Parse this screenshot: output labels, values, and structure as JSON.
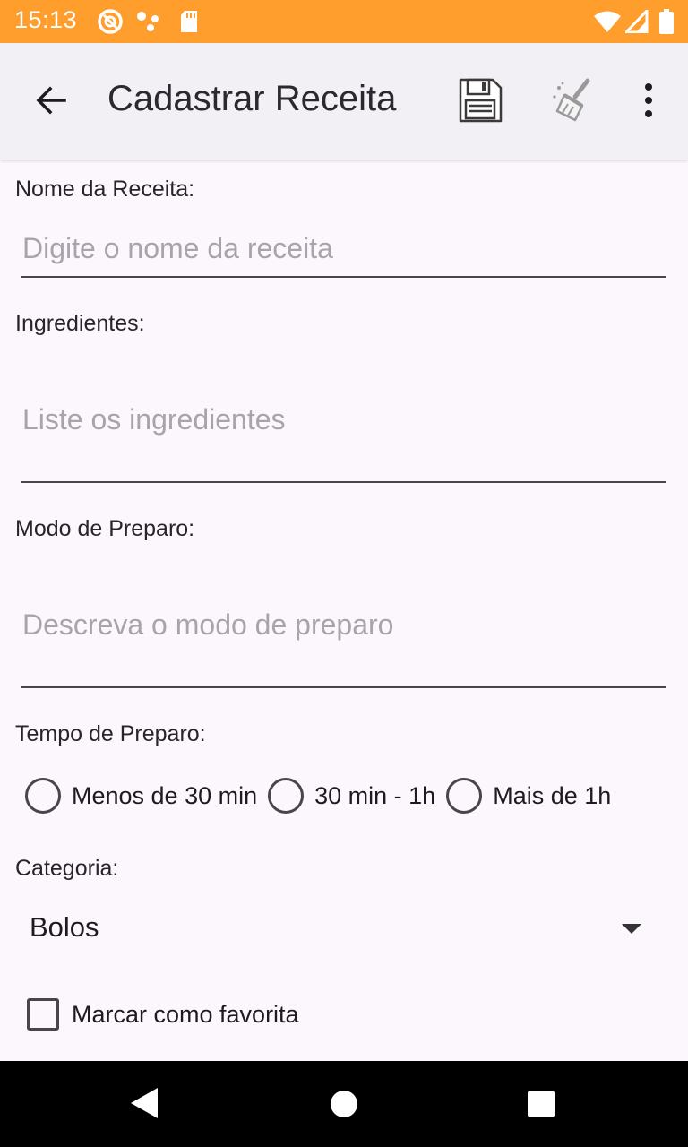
{
  "status_bar": {
    "time": "15:13",
    "icons": [
      "at-sign-icon",
      "dots-icon",
      "sd-card-icon",
      "wifi-icon",
      "signal-icon",
      "battery-icon"
    ],
    "background": "#ff9e2c"
  },
  "app_bar": {
    "title": "Cadastrar Receita",
    "actions": [
      "back-arrow-icon",
      "save-icon",
      "broom-icon",
      "more-vert-icon"
    ],
    "background": "#f2eff5"
  },
  "form": {
    "name": {
      "label": "Nome da Receita:",
      "placeholder": "Digite o nome da receita",
      "value": ""
    },
    "ingredients": {
      "label": "Ingredientes:",
      "placeholder": "Liste os ingredientes",
      "value": ""
    },
    "preparation": {
      "label": "Modo de Preparo:",
      "placeholder": "Descreva o modo de preparo",
      "value": ""
    },
    "prep_time": {
      "label": "Tempo de Preparo:",
      "options": [
        "Menos de 30 min",
        "30 min - 1h",
        "Mais de 1h"
      ]
    },
    "category": {
      "label": "Categoria:",
      "selected": "Bolos"
    },
    "favorite": {
      "label": "Marcar como favorita",
      "checked": false
    }
  },
  "nav_bar": {
    "icons": [
      "nav-back-icon",
      "nav-home-icon",
      "nav-recents-icon"
    ]
  }
}
